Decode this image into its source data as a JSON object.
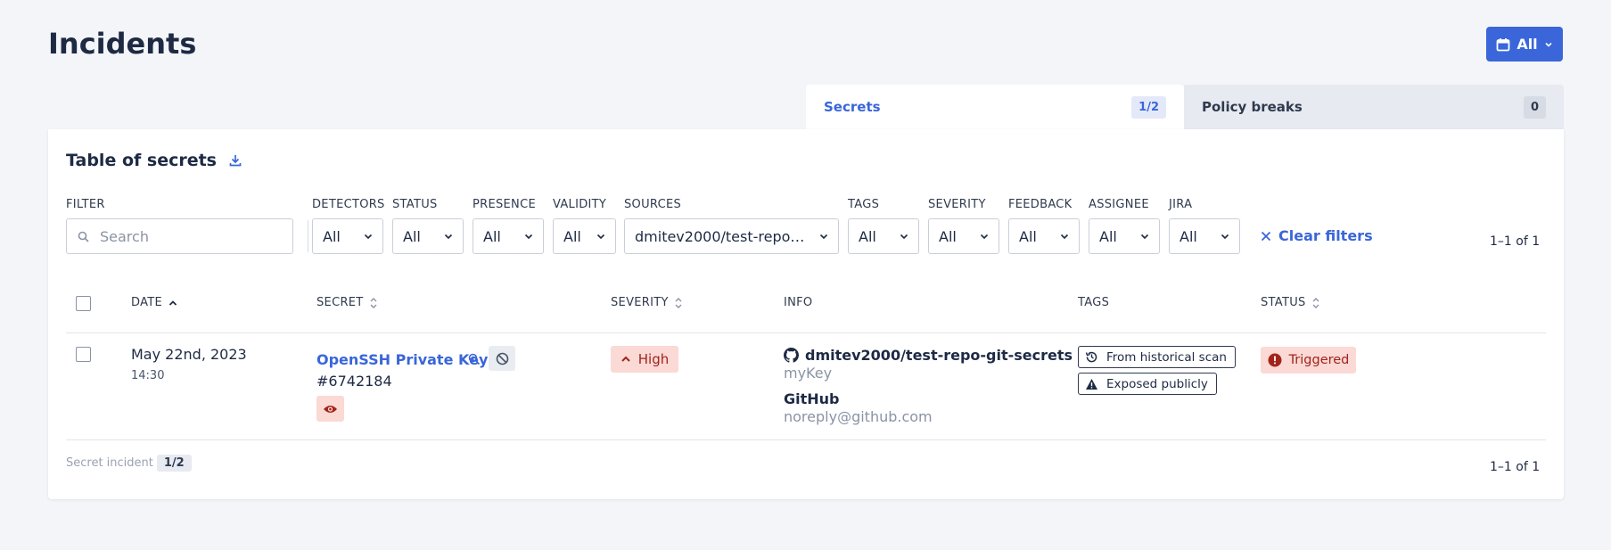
{
  "page": {
    "title": "Incidents"
  },
  "header": {
    "period_button_label": "All"
  },
  "tabs": [
    {
      "label": "Secrets",
      "count": "1/2"
    },
    {
      "label": "Policy breaks",
      "count": "0"
    }
  ],
  "table": {
    "title": "Table of secrets",
    "filters": {
      "search": {
        "label": "FILTER",
        "placeholder": "Search"
      },
      "selects": [
        {
          "label": "DETECTORS",
          "value": "All"
        },
        {
          "label": "STATUS",
          "value": "All"
        },
        {
          "label": "PRESENCE",
          "value": "All"
        },
        {
          "label": "VALIDITY",
          "value": "All"
        },
        {
          "label": "SOURCES",
          "value": "dmitev2000/test-repo…"
        },
        {
          "label": "TAGS",
          "value": "All"
        },
        {
          "label": "SEVERITY",
          "value": "All"
        },
        {
          "label": "FEEDBACK",
          "value": "All"
        },
        {
          "label": "ASSIGNEE",
          "value": "All"
        },
        {
          "label": "JIRA",
          "value": "All"
        }
      ],
      "clear_label": "Clear filters"
    },
    "pagination_top": "1–1 of 1",
    "columns": [
      "DATE",
      "SECRET",
      "SEVERITY",
      "INFO",
      "TAGS",
      "STATUS"
    ],
    "rows": [
      {
        "date": "May 22nd, 2023",
        "time": "14:30",
        "secret_name": "OpenSSH Private Key",
        "secret_id": "#6742184",
        "severity": "High",
        "repo": "dmitev2000/test-repo-git-secrets",
        "file": "myKey",
        "author": "GitHub",
        "email": "noreply@github.com",
        "tags": [
          "From historical scan",
          "Exposed publicly"
        ],
        "status": "Triggered"
      }
    ],
    "footer": {
      "label": "Secret incident",
      "count": "1/2"
    },
    "pagination_bottom": "1–1 of 1"
  },
  "colors": {
    "accent": "#3a66d9",
    "danger_bg": "#fbd9d5",
    "danger_text": "#a1241b",
    "page_bg": "#f3f5f8"
  },
  "icons": [
    "calendar-icon",
    "chevron-down-icon",
    "download-icon",
    "search-icon",
    "close-icon",
    "sort-up-icon",
    "sort-icon",
    "zoom-icon",
    "ban-icon",
    "eye-icon",
    "chevron-up-icon",
    "github-icon",
    "history-icon",
    "warning-icon",
    "alert-circle-icon"
  ]
}
